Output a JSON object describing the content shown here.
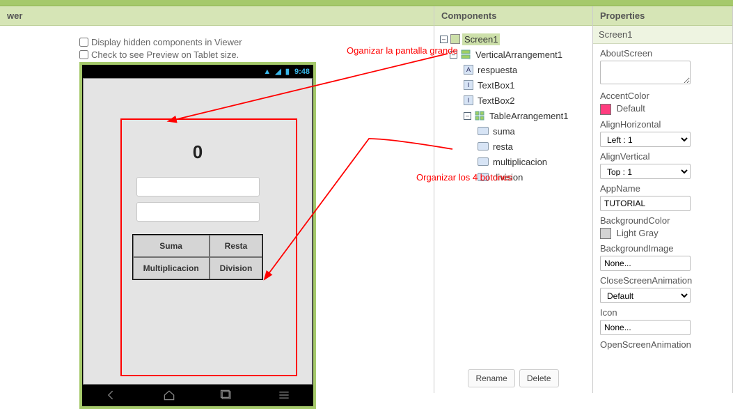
{
  "viewer": {
    "title": "wer",
    "display_hidden_label": "Display hidden components in Viewer",
    "tablet_preview_label": "Check to see Preview on Tablet size.",
    "status_time": "9:48",
    "respuesta_value": "0",
    "buttons": {
      "suma": "Suma",
      "resta": "Resta",
      "mult": "Multiplicacion",
      "div": "Division"
    }
  },
  "annotations": {
    "pantalla": "Oganizar la pantalla grande",
    "botones": "Organizar los 4 botones"
  },
  "components": {
    "title": "Components",
    "tree": {
      "screen": "Screen1",
      "vert": "VerticalArrangement1",
      "respuesta": "respuesta",
      "tb1": "TextBox1",
      "tb2": "TextBox2",
      "table": "TableArrangement1",
      "suma": "suma",
      "resta": "resta",
      "mult": "multiplicacion",
      "div": "division"
    },
    "rename": "Rename",
    "delete": "Delete"
  },
  "properties": {
    "title": "Properties",
    "target": "Screen1",
    "items": {
      "about": "AboutScreen",
      "accent": "AccentColor",
      "accent_val": "Default",
      "alignh": "AlignHorizontal",
      "alignh_val": "Left : 1",
      "alignv": "AlignVertical",
      "alignv_val": "Top : 1",
      "appname": "AppName",
      "appname_val": "TUTORIAL",
      "bgcolor": "BackgroundColor",
      "bgcolor_val": "Light Gray",
      "bgimg": "BackgroundImage",
      "bgimg_val": "None...",
      "closeanim": "CloseScreenAnimation",
      "closeanim_val": "Default",
      "icon": "Icon",
      "icon_val": "None...",
      "openanim": "OpenScreenAnimation"
    }
  }
}
